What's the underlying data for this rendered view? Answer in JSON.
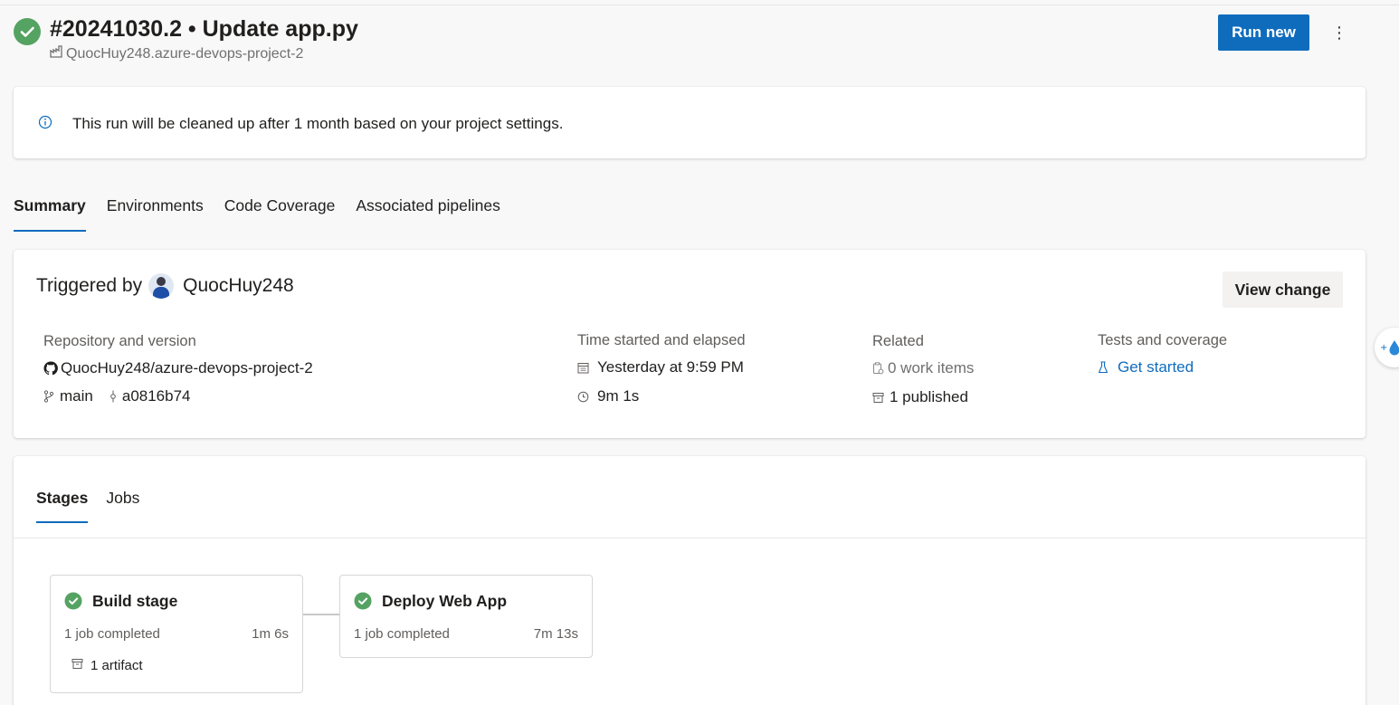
{
  "header": {
    "run_title": "#20241030.2 • Update app.py",
    "pipeline_name": "QuocHuy248.azure-devops-project-2",
    "run_new_label": "Run new",
    "more_label": "⋮"
  },
  "banner": {
    "text": "This run will be cleaned up after 1 month based on your project settings."
  },
  "tabs": [
    {
      "label": "Summary",
      "active": true
    },
    {
      "label": "Environments"
    },
    {
      "label": "Code Coverage"
    },
    {
      "label": "Associated pipelines"
    }
  ],
  "summary": {
    "triggered_by_label": "Triggered by",
    "triggered_by_user": "QuocHuy248",
    "view_change_label": "View change",
    "repository": {
      "label": "Repository and version",
      "repo": "QuocHuy248/azure-devops-project-2",
      "branch": "main",
      "commit": "a0816b74"
    },
    "time": {
      "label": "Time started and elapsed",
      "started": "Yesterday at 9:59 PM",
      "elapsed": "9m 1s"
    },
    "related": {
      "label": "Related",
      "work_items": "0 work items",
      "published": "1 published"
    },
    "tests": {
      "label": "Tests and coverage",
      "link": "Get started"
    }
  },
  "stages_card": {
    "tabs": [
      {
        "label": "Stages",
        "active": true
      },
      {
        "label": "Jobs"
      }
    ],
    "stages": [
      {
        "name": "Build stage",
        "jobs": "1 job completed",
        "duration": "1m 6s",
        "artifact": "1 artifact",
        "status": "succeeded"
      },
      {
        "name": "Deploy Web App",
        "jobs": "1 job completed",
        "duration": "7m 13s",
        "status": "succeeded"
      }
    ]
  },
  "colors": {
    "success": "#55a362",
    "accent": "#0f6cbd"
  }
}
